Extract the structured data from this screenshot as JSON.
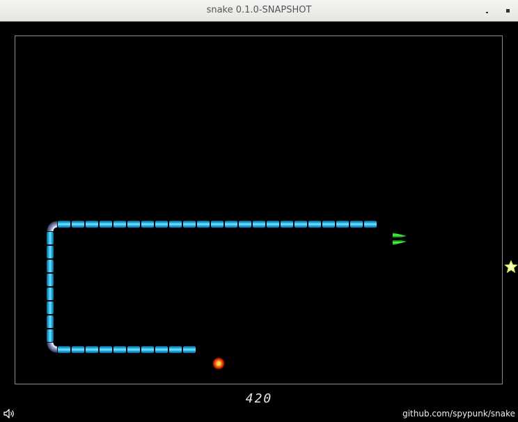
{
  "window": {
    "title": "snake 0.1.0-SNAPSHOT"
  },
  "game": {
    "score": "420",
    "link_text": "github.com/spypunk/snake",
    "snake_color": "#1fb6ee",
    "head_color": "#1ec81e",
    "food_color": "#e8ff7a",
    "board_border_color": "#8a8a8a",
    "snake": {
      "head": {
        "col": 26,
        "row": 13,
        "direction": "right"
      },
      "body_top_row": {
        "row": 13,
        "col_from": 3,
        "col_to": 25
      },
      "body_left_col": {
        "col": 2,
        "row_from": 14,
        "row_to": 21
      },
      "body_bottom_row": {
        "row": 22,
        "col_from": 3,
        "col_to": 12
      },
      "corners": [
        {
          "col": 2,
          "row": 13,
          "type": "top-left"
        },
        {
          "col": 2,
          "row": 22,
          "type": "bottom-left"
        }
      ],
      "tail": {
        "col": 13,
        "row": 22
      }
    },
    "food": {
      "col": 34,
      "row": 15,
      "icon": "star-icon"
    }
  }
}
